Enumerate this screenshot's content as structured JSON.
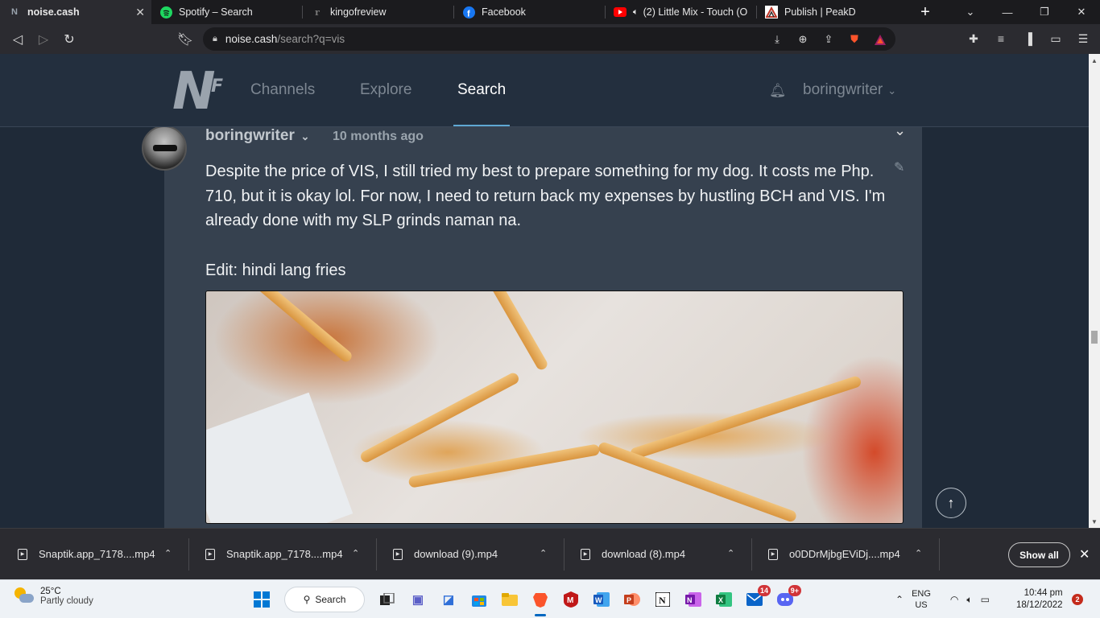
{
  "browser": {
    "tabs": [
      {
        "title": "noise.cash",
        "active": true,
        "icon": "noise-cash-favicon"
      },
      {
        "title": "Spotify – Search",
        "active": false,
        "icon": "spotify-icon"
      },
      {
        "title": "kingofreview",
        "active": false,
        "icon": "kingofreview-icon"
      },
      {
        "title": "Facebook",
        "active": false,
        "icon": "facebook-icon"
      },
      {
        "title": "(2) Little Mix - Touch (O",
        "active": false,
        "icon": "youtube-icon"
      },
      {
        "title": "Publish | PeakD",
        "active": false,
        "icon": "peakd-icon"
      }
    ],
    "url_domain": "noise.cash",
    "url_path": "/search?q=vis",
    "colors": {
      "active_tab": "#2b2b30",
      "tab_strip": "#1b1b1e",
      "brave_orange": "#fb542b"
    }
  },
  "site": {
    "logo_letter": "N",
    "logo_sup": "F",
    "nav": {
      "channels": "Channels",
      "explore": "Explore",
      "search": "Search",
      "active": "Search"
    },
    "user": "boringwriter",
    "colors": {
      "header_bg": "#232f3e",
      "card_bg": "#36414f",
      "accent": "#5fa8d3"
    }
  },
  "post": {
    "author": "boringwriter",
    "time": "10 months ago",
    "paragraph1": "Despite the price of VIS, I still tried my best to prepare something for my dog. It costs me Php. 710, but it is okay lol. For now, I need to return back my expenses by hustling BCH and VIS. I'm already done with my SLP grinds naman na.",
    "paragraph2": "Edit: hindi lang fries"
  },
  "downloads": {
    "items": [
      {
        "name": "Snaptik.app_7178....mp4"
      },
      {
        "name": "Snaptik.app_7178....mp4"
      },
      {
        "name": "download (9).mp4"
      },
      {
        "name": "download (8).mp4"
      },
      {
        "name": "o0DDrMjbgEViDj....mp4"
      }
    ],
    "show_all": "Show all"
  },
  "taskbar": {
    "weather_temp": "25°C",
    "weather_desc": "Partly cloudy",
    "search_label": "Search",
    "mail_badge": "14",
    "discord_badge": "9+",
    "lang_top": "ENG",
    "lang_bottom": "US",
    "time": "10:44 pm",
    "date": "18/12/2022",
    "notification_count": "2"
  }
}
